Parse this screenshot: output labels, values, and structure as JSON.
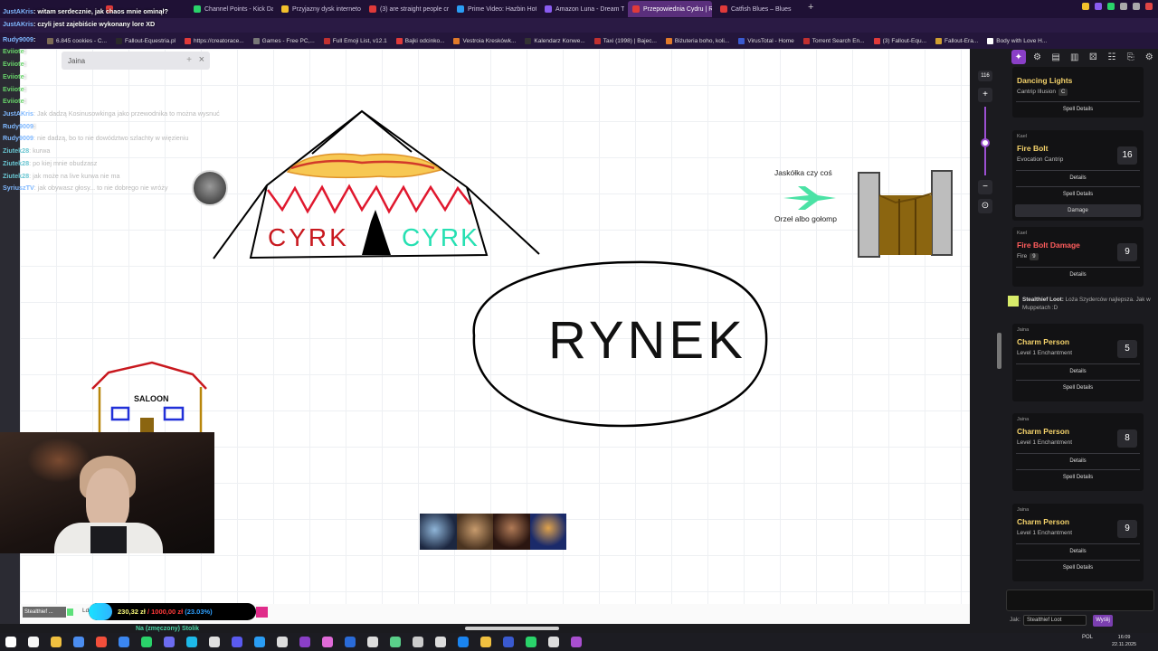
{
  "browser": {
    "tabs": [
      {
        "label": "",
        "color": "#e03a3a",
        "active": false
      },
      {
        "label": "Channel Points - Kick Da",
        "color": "#2ad36a",
        "active": false
      },
      {
        "label": "Przyjazny dysk internetow",
        "color": "#f2c02c",
        "active": false
      },
      {
        "label": "(3) are straight people cr",
        "color": "#e03a3a",
        "active": false
      },
      {
        "label": "Prime Video: Hazbin Hote",
        "color": "#2a9df4",
        "active": false
      },
      {
        "label": "Amazon Luna - Dream Ta",
        "color": "#8a5cf0",
        "active": false
      },
      {
        "label": "Przepowiednia Cydru | R",
        "color": "#e03a3a",
        "active": true
      },
      {
        "label": "Catfish Blues – Blues",
        "color": "#e03a3a",
        "active": false
      }
    ],
    "new_tab": "+",
    "bookmarks": [
      {
        "label": "6.845 cookies - C...",
        "color": "#7b6a55"
      },
      {
        "label": "Fallout-Equestria.pl",
        "color": "#2a2a2a"
      },
      {
        "label": "https://creatorace...",
        "color": "#e03a3a"
      },
      {
        "label": "Games - Free PC,...",
        "color": "#777"
      },
      {
        "label": "Full Emoji List, v12.1",
        "color": "#c03030"
      },
      {
        "label": "Bajki odcinko...",
        "color": "#e03a3a"
      },
      {
        "label": "Vestroia Kreskówk...",
        "color": "#e07a2a"
      },
      {
        "label": "Kalendarz Konwe...",
        "color": "#333"
      },
      {
        "label": "Taxi (1998) | Bajec...",
        "color": "#c03030"
      },
      {
        "label": "Biżuteria boho, koli...",
        "color": "#e07a2a"
      },
      {
        "label": "VirusTotal - Home",
        "color": "#3a5ad0"
      },
      {
        "label": "Torrent Search En...",
        "color": "#c03030"
      },
      {
        "label": "(3) Fallout-Equ...",
        "color": "#e03a3a"
      },
      {
        "label": "Fallout-Era...",
        "color": "#d0a030"
      },
      {
        "label": "Body with Love H...",
        "color": "#fff"
      }
    ]
  },
  "chat": [
    {
      "user": "JustAKris",
      "message": ": witam serdecznie, jak chaos mnie ominął?",
      "style": "c",
      "faint": false
    },
    {
      "user": "JustAKris",
      "message": ": czyli jest zajebiście wykonany lore XD",
      "style": "c",
      "faint": false
    },
    {
      "user": "Rudy9009",
      "message": ":",
      "style": "c",
      "faint": false
    },
    {
      "user": "Eviiote",
      "message": ":",
      "style": "g",
      "faint": false
    },
    {
      "user": "Eviiote",
      "message": ":",
      "style": "g",
      "faint": false
    },
    {
      "user": "Eviiote",
      "message": ":",
      "style": "g",
      "faint": false
    },
    {
      "user": "Eviiote",
      "message": ":",
      "style": "g",
      "faint": false
    },
    {
      "user": "Eviiote",
      "message": ":",
      "style": "g",
      "faint": false
    },
    {
      "user": "JustAKris",
      "message": ": Jak dadzą Kosinusowkinga jako przewodnika to można wysnuć",
      "style": "c",
      "faint": true
    },
    {
      "user": "Rudy9009",
      "message": ":",
      "style": "c",
      "faint": false
    },
    {
      "user": "Rudy9009",
      "message": ": nie dadzą, bo to nie dowództwo szlachty w więzieniu",
      "style": "c",
      "faint": true
    },
    {
      "user": "Ziutek28",
      "message": ": kurwa",
      "style": "t",
      "faint": true
    },
    {
      "user": "Ziutek28",
      "message": ": po kiej mnie obudzasz",
      "style": "t",
      "faint": true
    },
    {
      "user": "Ziutek28",
      "message": ": jak może na live kurwa nie ma",
      "style": "t",
      "faint": true
    },
    {
      "user": "SyriuszTV",
      "message": ": jak obywasz głosy... to nie dobrego nie wróży",
      "style": "c",
      "faint": true
    }
  ],
  "canvas_search": {
    "label": "Jaina",
    "add": "+",
    "close": "×"
  },
  "drawings": {
    "circus_left": "CYRK",
    "circus_right": "CYRK",
    "bird_top": "Jaskółka czy coś",
    "bird_bottom": "Orzeł albo gołomp",
    "saloon": "SALOON",
    "market": "RYNEK"
  },
  "zoom": {
    "level": "116",
    "plus": "+",
    "minus": "−",
    "reset": "⊙",
    "fraction": 0.52
  },
  "panel": {
    "tabs": [
      "spells-icon",
      "settings-icon",
      "notes-icon",
      "sheet-icon",
      "dice-icon",
      "chat-icon",
      "share-icon",
      "gear-icon"
    ],
    "cards": [
      {
        "owner": "",
        "title": "Dancing Lights",
        "title_color": "#f5d36b",
        "subtitle": "Cantrip Illusion",
        "badge": "C",
        "number": "",
        "actions": [
          "Spell Details"
        ]
      },
      {
        "owner": "Kael",
        "title": "Fire Bolt",
        "title_color": "#f5d36b",
        "subtitle": "Evocation Cantrip",
        "number": "16",
        "actions": [
          "Details",
          "Spell Details"
        ],
        "damage": "Damage"
      },
      {
        "owner": "Kael",
        "title": "Fire Bolt Damage",
        "title_color": "#ff5d5d",
        "subtitle": "Fire",
        "badge": "9",
        "number": "9",
        "actions": [
          "Details"
        ]
      },
      {
        "owner": "Jaina",
        "title": "Charm Person",
        "title_color": "#f5d36b",
        "subtitle": "Level 1 Enchantment",
        "number": "5",
        "actions": [
          "Details",
          "Spell Details"
        ]
      },
      {
        "owner": "Jaina",
        "title": "Charm Person",
        "title_color": "#f5d36b",
        "subtitle": "Level 1 Enchantment",
        "number": "8",
        "actions": [
          "Details",
          "Spell Details"
        ]
      },
      {
        "owner": "Jaina",
        "title": "Charm Person",
        "title_color": "#f5d36b",
        "subtitle": "Level 1 Enchantment",
        "number": "9",
        "actions": [
          "Details",
          "Spell Details"
        ]
      }
    ],
    "notice_user": "Stealthief Loot:",
    "notice_text": "Loża Szyderców najlepsza. Jak w Muppetach :D",
    "jak_label": "Jak:",
    "jak_value": "Stealthief Loot",
    "send_label": "Wyślij"
  },
  "overlay": {
    "stealth_tag": "Stealthief ...",
    "ld_label": "Ld",
    "donation_current": "230,32 zł",
    "donation_goal": "/ 1000,00 zł",
    "donation_pct": "(23.03%)",
    "donation_fraction": 0.2303,
    "under_text": "Na (zmęczony) Stolik"
  },
  "taskbar": {
    "lang": "POL",
    "time": "16:09",
    "date": "22.11.2025"
  },
  "colors": {
    "accent": "#8a3fc7",
    "spell_gold": "#f5d36b",
    "spell_red": "#ff5d5d"
  }
}
